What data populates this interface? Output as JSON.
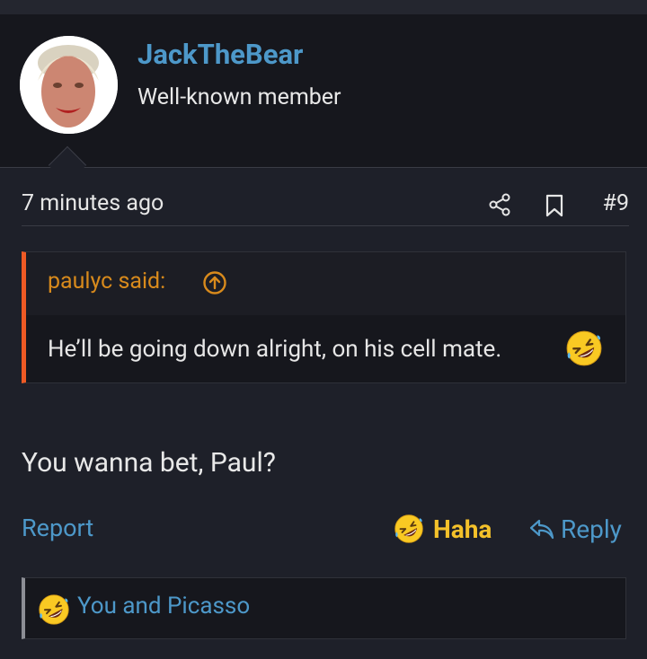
{
  "post": {
    "username": "JackTheBear",
    "user_title": "Well-known member",
    "time": "7 minutes ago",
    "post_number": "#9",
    "body": "You wanna bet, Paul?"
  },
  "quote": {
    "author": "paulyc said:",
    "text": "He’ll be going down alright, on his cell mate."
  },
  "actions": {
    "report": "Report",
    "reaction": "Haha",
    "reply": "Reply"
  },
  "reactions_summary": "You and Picasso",
  "icons": {
    "share": "share-icon",
    "bookmark": "bookmark-icon",
    "quote_jump": "arrow-up-circle-icon",
    "reply": "reply-arrow-icon",
    "emoji": "rolling-laughing-emoji"
  },
  "colors": {
    "link": "#4d98c9",
    "quote_accent": "#ef5a24",
    "quote_author": "#d88a1c",
    "haha": "#f4c12a"
  }
}
